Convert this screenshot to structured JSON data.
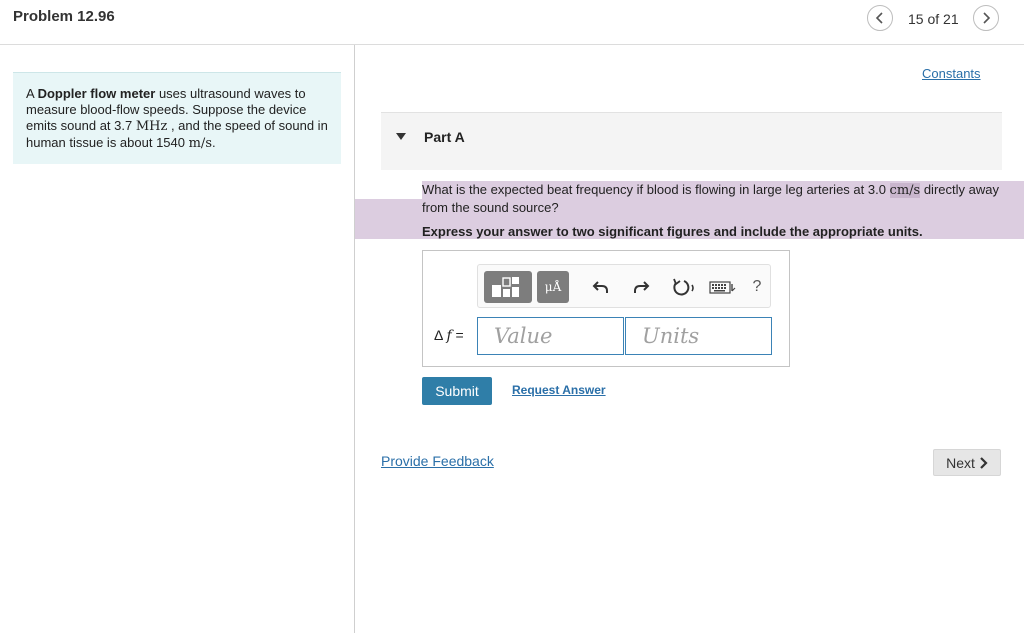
{
  "header": {
    "problem_title": "Problem 12.96",
    "page_counter": "15 of 21"
  },
  "intro": {
    "pre_bold": "A ",
    "bold": "Doppler flow meter",
    "text1": " uses ultrasound waves to measure blood-flow speeds. Suppose the device emits sound at 3.7 ",
    "unit1": "MHz",
    "text2": " , and the speed of sound in human tissue is about 1540 ",
    "unit2": "m/s",
    "text3": "."
  },
  "constants_link": "Constants",
  "part": {
    "title": "Part A"
  },
  "question": {
    "text1": "What is the expected beat frequency if blood is flowing in large leg arteries at 3.0 ",
    "unit": "cm/s",
    "text2": " directly away from the sound source?"
  },
  "instruction": "Express your answer to two significant figures and include the appropriate units.",
  "answer": {
    "label_symbol": "Δ",
    "label_var": "f",
    "label_eq": " =",
    "value_placeholder": "Value",
    "units_placeholder": "Units"
  },
  "toolbar": {
    "units_button": "μÅ",
    "help": "?"
  },
  "actions": {
    "submit": "Submit",
    "request_answer": "Request Answer",
    "provide_feedback": "Provide Feedback",
    "next": "Next"
  },
  "colors": {
    "accent": "#2f7ea8",
    "link": "#2a6fa8",
    "intro_bg": "#e8f6f7",
    "highlight": "#dccde0"
  }
}
